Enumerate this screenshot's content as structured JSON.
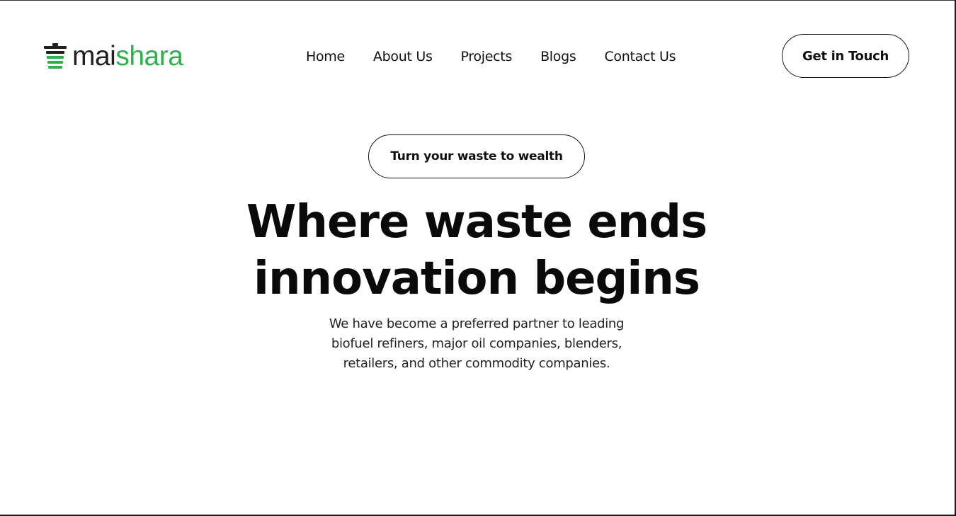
{
  "brand": {
    "name_part1": "mai",
    "name_part2": "shara",
    "accent_color": "#2db24a",
    "dark_color": "#1f1f1f",
    "icon": "trash-bin-icon"
  },
  "nav": {
    "items": [
      {
        "label": "Home"
      },
      {
        "label": "About Us"
      },
      {
        "label": "Projects"
      },
      {
        "label": "Blogs"
      },
      {
        "label": "Contact Us"
      }
    ]
  },
  "header": {
    "cta_label": "Get in Touch"
  },
  "hero": {
    "tagline": "Turn your waste to wealth",
    "headline_line1": "Where waste ends",
    "headline_line2": "innovation begins",
    "description_lines": [
      "We have become a preferred partner to leading",
      "biofuel refiners, major oil companies, blenders,",
      "retailers, and other commodity companies."
    ]
  }
}
